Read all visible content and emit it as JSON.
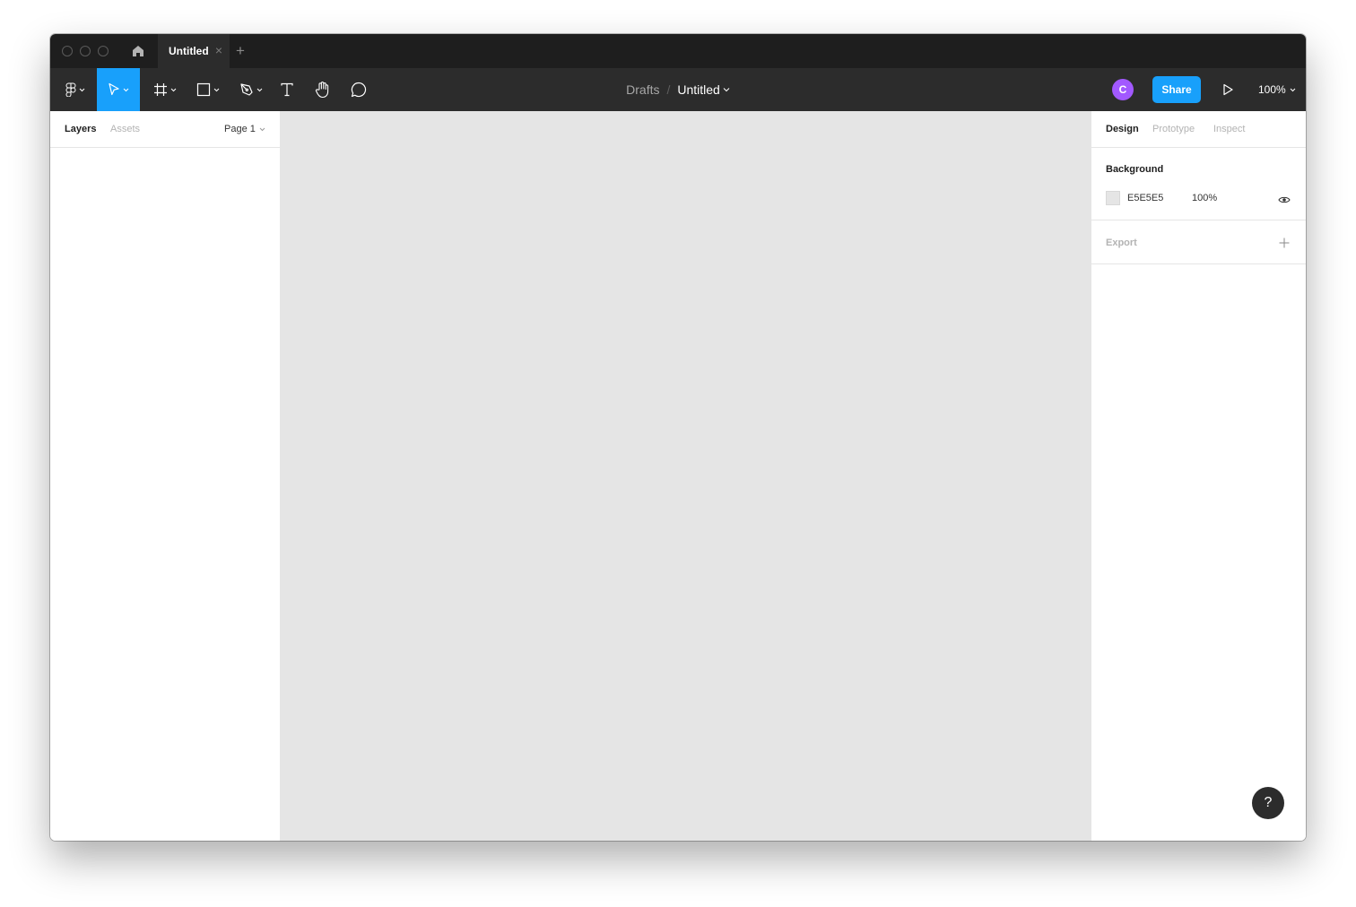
{
  "titlebar": {
    "tab_label": "Untitled",
    "tab_close": "×",
    "new_tab": "+"
  },
  "toolbar": {
    "tools": [
      {
        "name": "main-menu",
        "icon": "figma-logo-icon"
      },
      {
        "name": "move",
        "icon": "cursor-arrow-icon",
        "active": true
      },
      {
        "name": "frame",
        "icon": "frame-hash-icon"
      },
      {
        "name": "rectangle",
        "icon": "rectangle-icon"
      },
      {
        "name": "pen",
        "icon": "pen-nib-icon"
      },
      {
        "name": "text",
        "icon": "text-t-icon"
      },
      {
        "name": "hand",
        "icon": "hand-icon"
      },
      {
        "name": "comment",
        "icon": "speech-bubble-icon"
      }
    ],
    "breadcrumb_parent": "Drafts",
    "breadcrumb_separator": "/",
    "file_title": "Untitled",
    "avatar_initial": "C",
    "share_label": "Share",
    "zoom": "100%"
  },
  "left_panel": {
    "tab_layers": "Layers",
    "tab_assets": "Assets",
    "page": "Page 1"
  },
  "right_panel": {
    "tab_design": "Design",
    "tab_prototype": "Prototype",
    "tab_inspect": "Inspect",
    "background_title": "Background",
    "background_hex": "E5E5E5",
    "background_opacity": "100%",
    "export_title": "Export"
  },
  "help_label": "?",
  "colors": {
    "accent": "#18A0FB",
    "avatar": "#A259FF",
    "toolbar": "#2C2C2C",
    "canvas": "#E5E5E5"
  }
}
